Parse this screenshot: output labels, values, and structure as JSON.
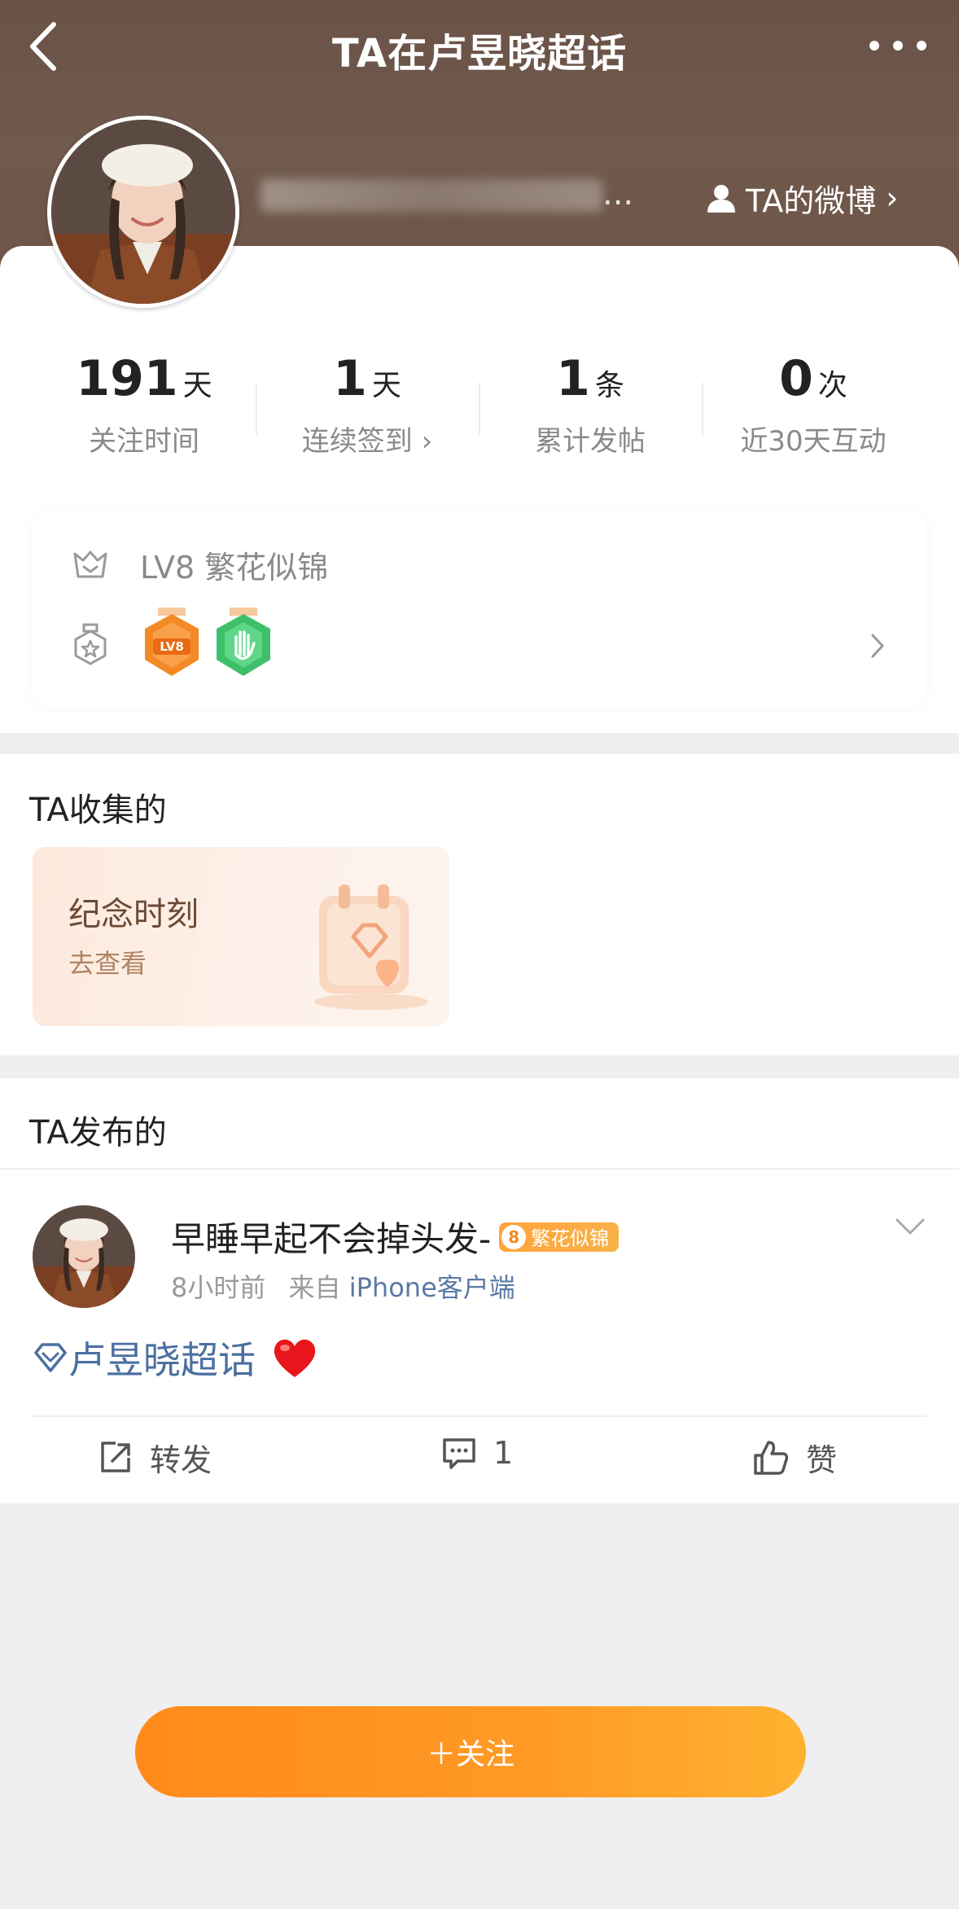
{
  "nav": {
    "title": "TA在卢昱晓超话",
    "back_icon": "chevron-left-icon",
    "more_icon": "more-horizontal-icon"
  },
  "profile": {
    "username_suffix": "...",
    "weibo_link": "TA的微博",
    "weibo_link_chevron": "›"
  },
  "stats": [
    {
      "num": "191",
      "unit": "天",
      "label": "关注时间"
    },
    {
      "num": "1",
      "unit": "天",
      "label": "连续签到 ›"
    },
    {
      "num": "1",
      "unit": "条",
      "label": "累计发帖"
    },
    {
      "num": "0",
      "unit": "次",
      "label": "近30天互动"
    }
  ],
  "level": {
    "text": "LV8 繁花似锦",
    "badge1_label": "LV8"
  },
  "collect": {
    "title": "TA收集的",
    "card_title": "纪念时刻",
    "card_sub": "去查看"
  },
  "posts": {
    "title": "TA发布的",
    "items": [
      {
        "author": "早睡早起不会掉头发-",
        "badge_level": "8",
        "badge_text": "繁花似锦",
        "time": "8小时前",
        "from_prefix": "来自",
        "source": "iPhone客户端",
        "content": "卢昱晓超话",
        "repost_label": "转发",
        "comment_count": "1",
        "like_label": "赞"
      }
    ]
  },
  "follow_button": "＋关注",
  "colors": {
    "header_bg": "#6e5648",
    "accent_orange": "#ff9a25",
    "link_blue": "#4b6fa0"
  }
}
